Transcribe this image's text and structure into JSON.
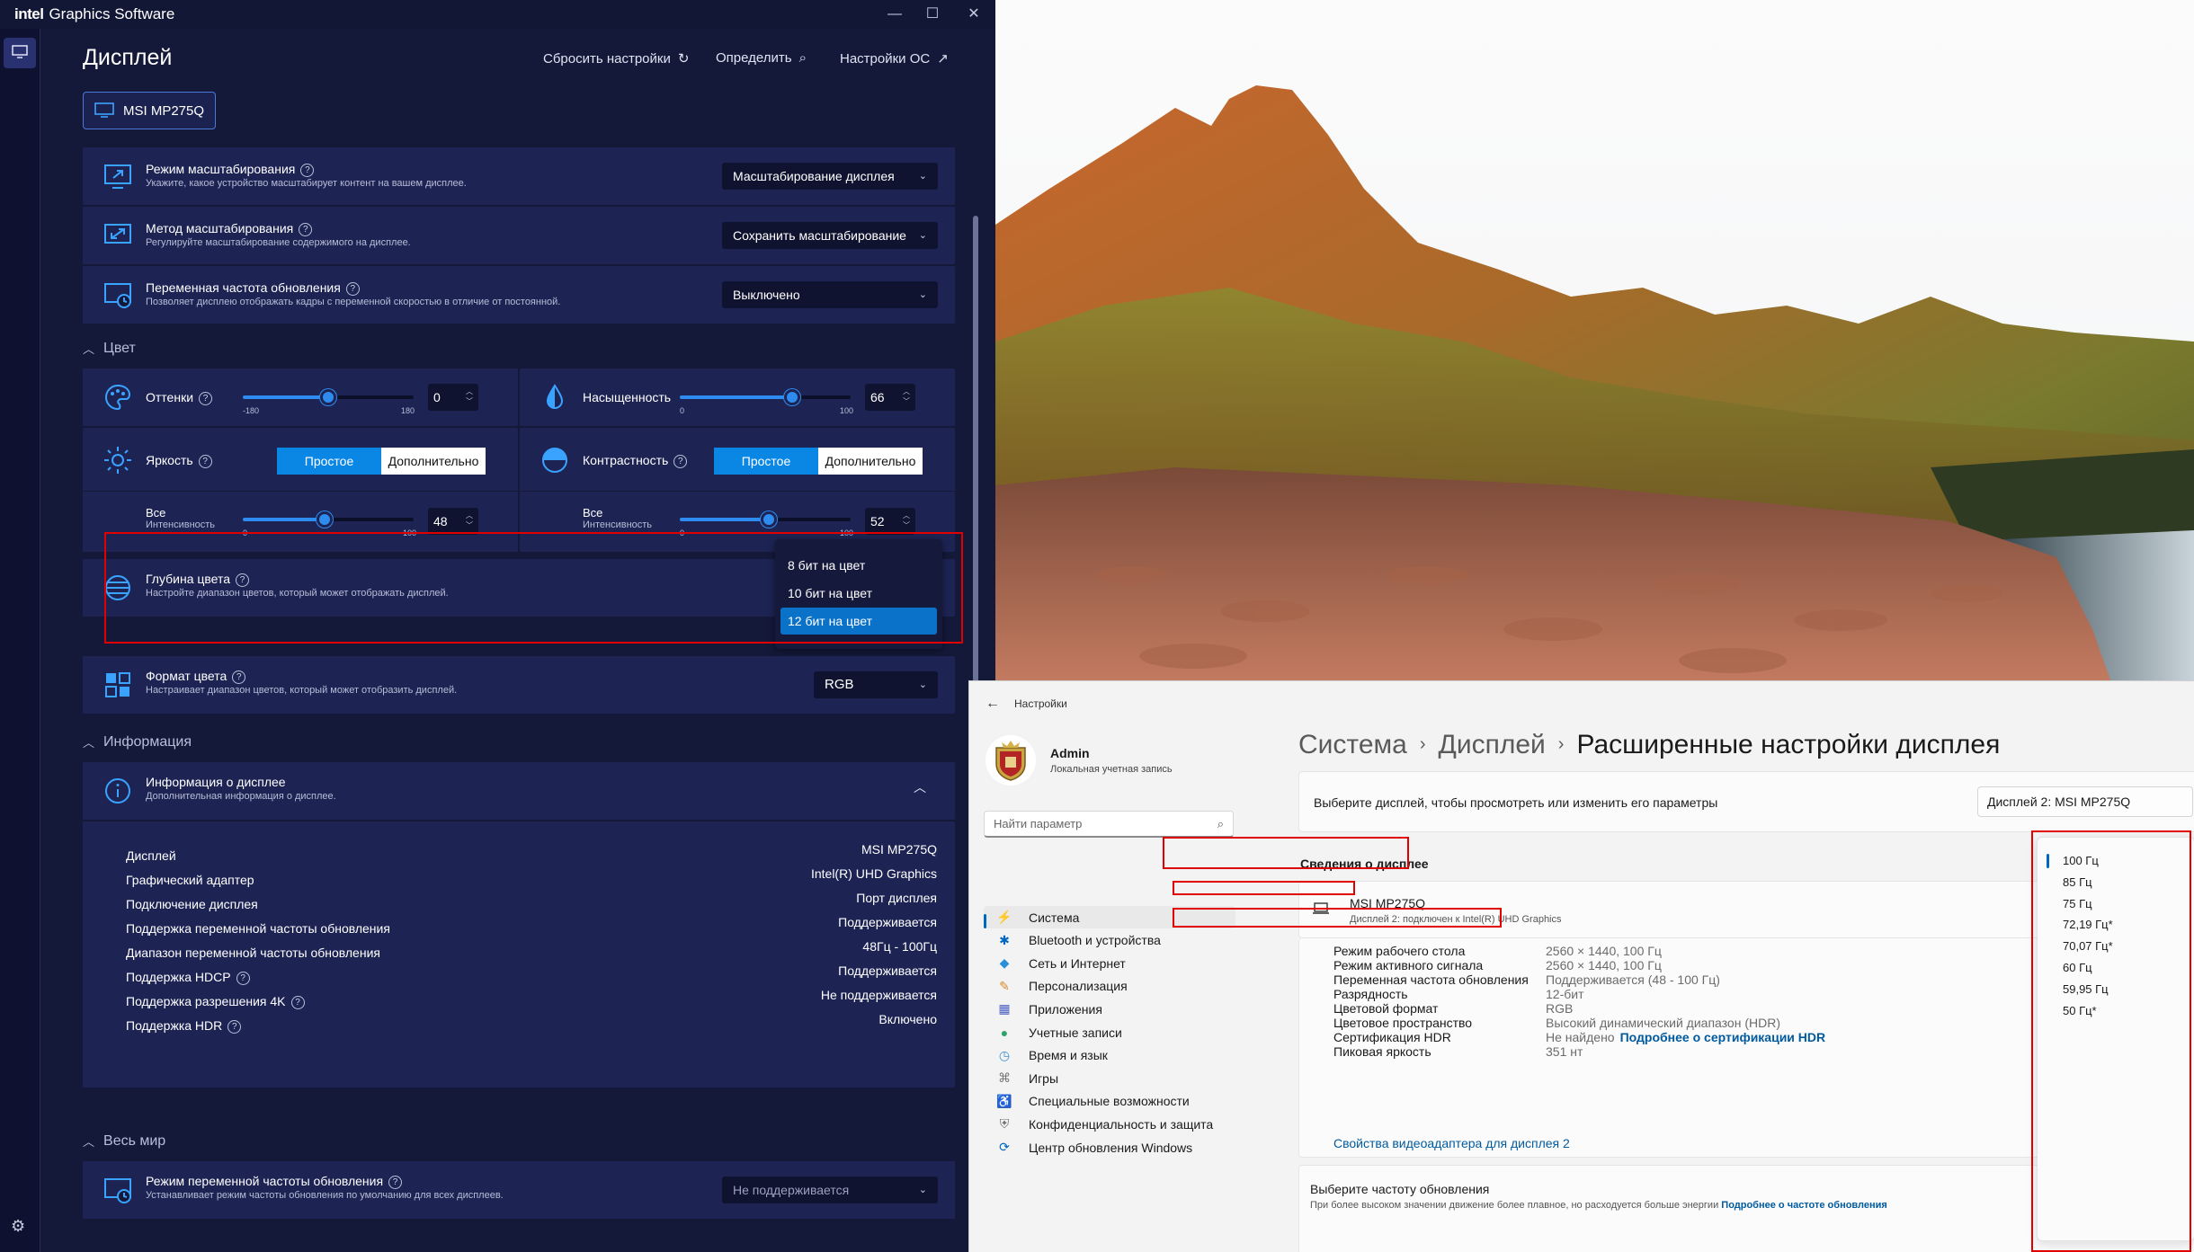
{
  "intel": {
    "logo": "intel",
    "app_name": "Graphics Software",
    "page_title": "Дисплей",
    "links": {
      "reset": "Сбросить настройки",
      "identify": "Определить",
      "os_settings": "Настройки ОС"
    },
    "monitor_button": "MSI MP275Q",
    "scaling_mode": {
      "title": "Режим масштабирования",
      "desc": "Укажите, какое устройство масштабирует контент на вашем дисплее.",
      "value": "Масштабирование дисплея"
    },
    "scaling_method": {
      "title": "Метод масштабирования",
      "desc": "Регулируйте масштабирование содержимого на дисплее.",
      "value": "Сохранить масштабирование"
    },
    "vrr": {
      "title": "Переменная частота обновления",
      "desc": "Позволяет дисплею отображать кадры с переменной скоростью в отличие от постоянной.",
      "value": "Выключено"
    },
    "color_section": "Цвет",
    "hue": {
      "label": "Оттенки",
      "min": "-180",
      "max": "180",
      "value": "0",
      "fraction": 0.5
    },
    "saturation": {
      "label": "Насыщенность",
      "min": "0",
      "max": "100",
      "value": "66",
      "fraction": 0.66
    },
    "brightness": {
      "label": "Яркость",
      "simple": "Простое",
      "advanced": "Дополнительно",
      "channel": "Все",
      "sub": "Интенсивность",
      "min": "0",
      "max": "100",
      "value": "48",
      "fraction": 0.48
    },
    "contrast": {
      "label": "Контрастность",
      "simple": "Простое",
      "advanced": "Дополнительно",
      "channel": "Все",
      "sub": "Интенсивность",
      "min": "0",
      "max": "100",
      "value": "52",
      "fraction": 0.52
    },
    "depth": {
      "title": "Глубина цвета",
      "desc": "Настройте диапазон цветов, который может отображать дисплей.",
      "options": [
        "8 бит на цвет",
        "10 бит на цвет",
        "12 бит на цвет"
      ],
      "selected": "12 бит на цвет"
    },
    "format": {
      "title": "Формат цвета",
      "desc": "Настраивает диапазон цветов, который может отобразить дисплей.",
      "value": "RGB"
    },
    "info_section": "Информация",
    "info_card": {
      "title": "Информация о дисплее",
      "desc": "Дополнительная информация о дисплее."
    },
    "info_rows": [
      {
        "k": "Дисплей",
        "v": "MSI MP275Q"
      },
      {
        "k": "Графический адаптер",
        "v": "Intel(R) UHD Graphics"
      },
      {
        "k": "Подключение дисплея",
        "v": "Порт дисплея"
      },
      {
        "k": "Поддержка переменной частоты обновления",
        "v": "Поддерживается"
      },
      {
        "k": "Диапазон переменной частоты обновления",
        "v": "48Гц - 100Гц"
      },
      {
        "k": "Поддержка HDCP",
        "v": "Поддерживается"
      },
      {
        "k": "Поддержка разрешения 4K",
        "v": "Не поддерживается"
      },
      {
        "k": "Поддержка HDR",
        "v": "Включено"
      }
    ],
    "world_section": "Весь мир",
    "world_vrr": {
      "title": "Режим переменной частоты обновления",
      "desc": "Устанавливает режим частоты обновления по умолчанию для всех дисплеев.",
      "value": "Не поддерживается"
    }
  },
  "settings": {
    "app_title": "Настройки",
    "user_name": "Admin",
    "user_type": "Локальная учетная запись",
    "search_placeholder": "Найти параметр",
    "nav": [
      "Система",
      "Bluetooth и устройства",
      "Сеть и Интернет",
      "Персонализация",
      "Приложения",
      "Учетные записи",
      "Время и язык",
      "Игры",
      "Специальные возможности",
      "Конфиденциальность и защита",
      "Центр обновления Windows"
    ],
    "crumb": [
      "Система",
      "Дисплей",
      "Расширенные настройки дисплея"
    ],
    "pick_text": "Выберите дисплей, чтобы просмотреть или изменить его параметры",
    "pick_value": "Дисплей 2: MSI MP275Q",
    "info_heading": "Сведения о дисплее",
    "display_name": "MSI MP275Q",
    "display_sub": "Дисплей 2: подключен к Intel(R) UHD Graphics",
    "props": [
      {
        "k": "Режим рабочего стола",
        "v": "2560 × 1440, 100 Гц"
      },
      {
        "k": "Режим активного сигнала",
        "v": "2560 × 1440, 100 Гц"
      },
      {
        "k": "Переменная частота обновления",
        "v": "Поддерживается (48 - 100 Гц)"
      },
      {
        "k": "Разрядность",
        "v": "12-бит"
      },
      {
        "k": "Цветовой формат",
        "v": "RGB"
      },
      {
        "k": "Цветовое пространство",
        "v": "Высокий динамический диапазон (HDR)"
      },
      {
        "k": "Сертификация HDR",
        "v": "Не найдено"
      },
      {
        "k": "Пиковая яркость",
        "v": "351 нт"
      }
    ],
    "hdr_link": "Подробнее о сертификации HDR",
    "adapter_link": "Свойства видеоадаптера для дисплея 2",
    "refresh_title": "Выберите частоту обновления",
    "refresh_desc": "При более высоком значении движение более плавное, но расходуется больше энергии",
    "refresh_link": "Подробнее о частоте обновления",
    "rates": [
      "100 Гц",
      "85 Гц",
      "75 Гц",
      "72,19 Гц*",
      "70,07 Гц*",
      "60 Гц",
      "59,95 Гц",
      "50 Гц*"
    ]
  },
  "colors": {
    "intel_bg": "#14193a",
    "accent": "#2e8cf0",
    "highlight": "#e00000",
    "win_link": "#005a9e"
  }
}
